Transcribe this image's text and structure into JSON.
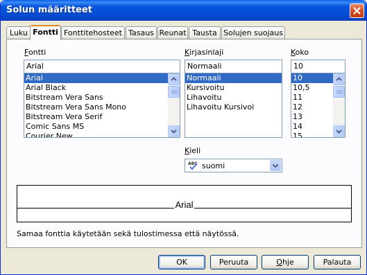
{
  "window": {
    "title": "Solun määritteet"
  },
  "tabs": [
    "Luku",
    "Fontti",
    "Fonttitehosteet",
    "Tasaus",
    "Reunat",
    "Tausta",
    "Solujen suojaus"
  ],
  "font": {
    "label": "Fontti",
    "value": "Arial",
    "options": [
      "Arial",
      "Arial Black",
      "Bitstream Vera Sans",
      "Bitstream Vera Sans Mono",
      "Bitstream Vera Serif",
      "Comic Sans MS",
      "Courier New"
    ],
    "selected": "Arial"
  },
  "style": {
    "label": "Kirjasinlaji",
    "value": "Normaali",
    "options": [
      "Normaali",
      "Kursivoitu",
      "Lihavoitu",
      "Lihavoitu Kursivoi"
    ],
    "selected": "Normaali"
  },
  "size": {
    "label": "Koko",
    "value": "10",
    "options": [
      "10",
      "10,5",
      "11",
      "12",
      "13",
      "14",
      "15"
    ],
    "selected": "10"
  },
  "language": {
    "label": "Kieli",
    "value": "suomi",
    "icon_text": "ABC"
  },
  "preview": {
    "text": "Arial"
  },
  "info": "Samaa fonttia käytetään sekä tulostimessa että näytössä.",
  "buttons": {
    "ok": "OK",
    "cancel": "Peruuta",
    "help": "Ohje",
    "reset": "Palauta"
  },
  "colors": {
    "selection": "#316ac5",
    "titlebar": "#0855dd",
    "tab_highlight": "#e68b2c"
  }
}
